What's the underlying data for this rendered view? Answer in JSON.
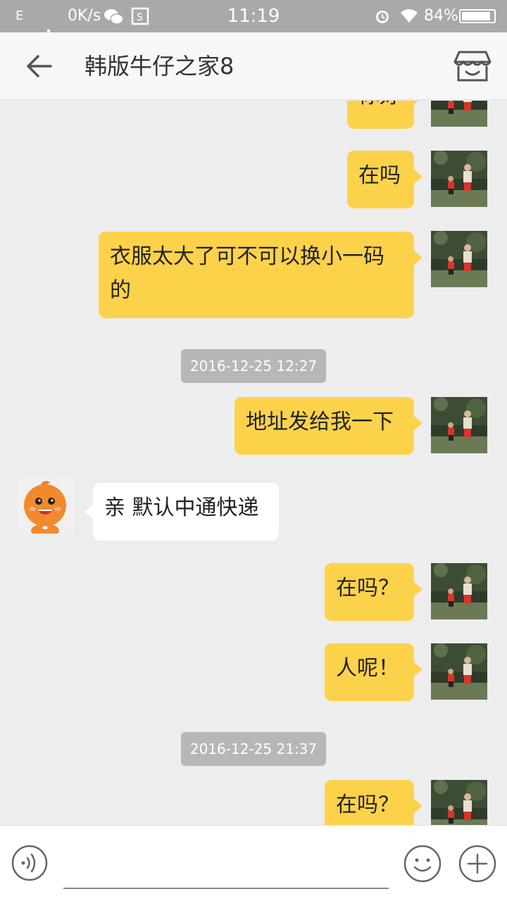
{
  "status_bar": {
    "network": "E",
    "speed": "0K/s",
    "time": "11:19",
    "battery": "84%",
    "battery_level": 0.84
  },
  "header": {
    "title": "韩版牛仔之家8"
  },
  "messages": [
    {
      "text": "你好"
    },
    {
      "text": "在吗"
    },
    {
      "text": "衣服太大了可不可以换小一码的"
    },
    {
      "timestamp": "2016-12-25 12:27"
    },
    {
      "text": "地址发给我一下"
    },
    {
      "text": "亲 默认中通快递"
    },
    {
      "text": "在吗？"
    },
    {
      "text": "人呢！"
    },
    {
      "timestamp": "2016-12-25 21:37"
    },
    {
      "text": "在吗？"
    }
  ],
  "input": {
    "value": ""
  },
  "colors": {
    "bubble_out": "#fdd24b",
    "bubble_in": "#ffffff",
    "background": "#ededed",
    "status_bar": "#a9a9a9"
  }
}
